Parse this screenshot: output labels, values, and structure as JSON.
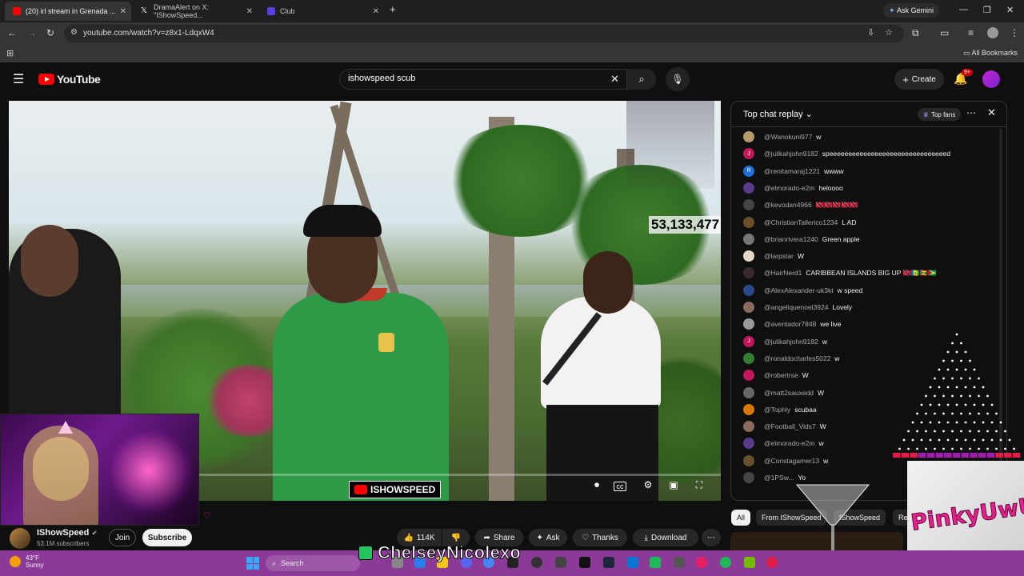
{
  "browser": {
    "tabs": [
      {
        "title": "(20) irl stream in Grenada ..."
      },
      {
        "title": "DramaAlert on X: \"IShowSpeed..."
      },
      {
        "title": "Club"
      }
    ],
    "ask_gemini": "Ask Gemini",
    "url": "youtube.com/watch?v=z8x1-LdqxW4",
    "all_bookmarks": "All Bookmarks"
  },
  "youtube": {
    "logo_text": "YouTube",
    "search": {
      "value": "ishowspeed scub"
    },
    "create_label": "Create",
    "notif_count": "9+"
  },
  "video": {
    "counter": "53,133,477",
    "watermark": "ISHOWSPEED"
  },
  "channel": {
    "name": "IShowSpeed",
    "subscribers": "53.1M subscribers",
    "join_label": "Join",
    "subscribe_label": "Subscribe"
  },
  "actions": {
    "likes": "114K",
    "share": "Share",
    "ask": "Ask",
    "thanks": "Thanks",
    "download": "Download"
  },
  "chat": {
    "title": "Top chat replay",
    "top_fans": "Top fans",
    "messages": [
      {
        "author": "@Wanokuni977",
        "text": "w",
        "color": "#b59a6a",
        "initial": ""
      },
      {
        "author": "@julikahjohn9182",
        "text": "speeeeeeeeeeeeeeeeeeeeeeeeeeeeeeed",
        "color": "#c2185b",
        "initial": "J"
      },
      {
        "author": "@renitamaraj1221",
        "text": "wwww",
        "color": "#1e6fd9",
        "initial": "R"
      },
      {
        "author": "@elmorado-e2m",
        "text": "heloooo",
        "color": "#5a3a8a",
        "initial": ""
      },
      {
        "author": "@kevodan4966",
        "text": "🇹🇹🇹🇹🇹🇹🇹🇹🇹🇹",
        "color": "#444444",
        "initial": ""
      },
      {
        "author": "@ChristianTallerico1234",
        "text": "L AD",
        "color": "#6b4f2a",
        "initial": ""
      },
      {
        "author": "@brianrivera1240",
        "text": "Green apple",
        "color": "#777777",
        "initial": ""
      },
      {
        "author": "@larpstar",
        "text": "W",
        "color": "#e5d9c5",
        "initial": ""
      },
      {
        "author": "@HairNerd1",
        "text": "CARIBBEAN ISLANDS BIG UP 🇹🇹🇻🇨🇬🇩🇬🇾",
        "color": "#3a2a2a",
        "initial": ""
      },
      {
        "author": "@AlexAlexander-uk3kt",
        "text": "w speed",
        "color": "#2a4a8a",
        "initial": ""
      },
      {
        "author": "@angeliquenoel3924",
        "text": "Lovely",
        "color": "#8a6a5a",
        "initial": ""
      },
      {
        "author": "@aventador7848",
        "text": "we live",
        "color": "#999999",
        "initial": ""
      },
      {
        "author": "@julikahjohn9182",
        "text": "w",
        "color": "#c2185b",
        "initial": "J"
      },
      {
        "author": "@ronaldocharles5022",
        "text": "w",
        "color": "#2f7d32",
        "initial": ""
      },
      {
        "author": "@robertrse",
        "text": "W",
        "color": "#c2185b",
        "initial": ""
      },
      {
        "author": "@matt2sauxedd",
        "text": "W",
        "color": "#666666",
        "initial": ""
      },
      {
        "author": "@Tophly",
        "text": "scubaa",
        "color": "#d97706",
        "initial": ""
      },
      {
        "author": "@Football_Vids7",
        "text": "W",
        "color": "#8a6a5a",
        "initial": ""
      },
      {
        "author": "@elmorado-e2m",
        "text": "w",
        "color": "#5a3a8a",
        "initial": ""
      },
      {
        "author": "@Constagamer13",
        "text": "w",
        "color": "#6b4f2a",
        "initial": ""
      },
      {
        "author": "@1PSw...",
        "text": "Yo",
        "color": "#444444",
        "initial": ""
      }
    ]
  },
  "chips": {
    "all": "All",
    "from": "From IShowSpeed",
    "ishowspeed": "IShowSpeed",
    "re": "Re"
  },
  "overlay": {
    "streamer_name": "ChelseyNicolexo",
    "logo_text": "PinkyUwU"
  },
  "taskbar": {
    "temp": "43°F",
    "weather": "Sunny",
    "search": "Search"
  }
}
